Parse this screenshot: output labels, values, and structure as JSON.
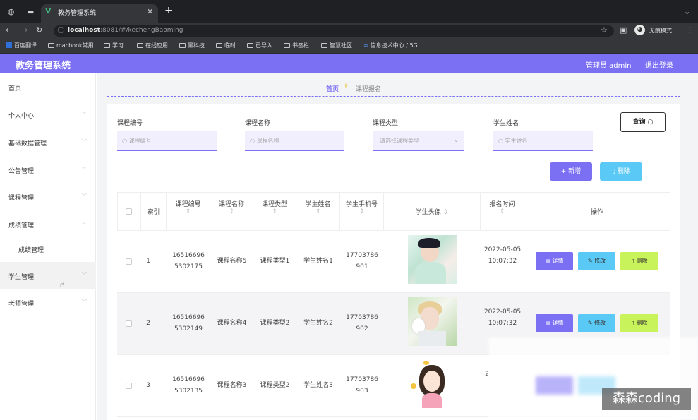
{
  "browser": {
    "tab_title": "教务管理系统",
    "url_host": "localhost",
    "url_rest": ":8081/#/kechengBaoming",
    "incognito_label": "无痕模式",
    "bookmarks": [
      "百度翻译",
      "macbook常用",
      "学习",
      "在线应用",
      "黑科技",
      "临时",
      "已导入",
      "书签栏",
      "智慧社区",
      "信息技术中心 / 5G..."
    ]
  },
  "header": {
    "title": "教务管理系统",
    "user": "管理员 admin",
    "logout": "退出登录"
  },
  "sidebar": {
    "items": [
      "首页",
      "个人中心",
      "基础数据管理",
      "公告管理",
      "课程管理",
      "成绩管理",
      "成绩管理",
      "学生管理",
      "老师管理"
    ]
  },
  "breadcrumb": {
    "home": "首页",
    "current": "课程报名"
  },
  "filters": {
    "course_code_label": "课程编号",
    "course_code_placeholder": "课程编号",
    "course_name_label": "课程名称",
    "course_name_placeholder": "课程名称",
    "course_type_label": "课程类型",
    "course_type_placeholder": "请选择课程类型",
    "student_name_label": "学生姓名",
    "student_name_placeholder": "学生姓名",
    "query_button": "查询"
  },
  "actions": {
    "add": "新增",
    "delete": "删除"
  },
  "table": {
    "headers": [
      "索引",
      "课程编号",
      "课程名称",
      "课程类型",
      "学生姓名",
      "学生手机号",
      "学生头像",
      "报名时间",
      "操作"
    ],
    "rows": [
      {
        "index": "1",
        "code": "16516696 5302175",
        "name": "课程名称5",
        "type": "课程类型1",
        "student": "学生姓名1",
        "phone": "17703786 901",
        "time": "2022-05-05 10:07:32"
      },
      {
        "index": "2",
        "code": "16516696 5302149",
        "name": "课程名称4",
        "type": "课程类型2",
        "student": "学生姓名2",
        "phone": "17703786 902",
        "time": "2022-05-05 10:07:32"
      },
      {
        "index": "3",
        "code": "16516696 5302135",
        "name": "课程名称3",
        "type": "课程类型2",
        "student": "学生姓名3",
        "phone": "17703786 903",
        "time": "2"
      }
    ],
    "op_detail": "详情",
    "op_edit": "修改",
    "op_delete": "删除"
  },
  "watermark": "森森coding",
  "colors": {
    "primary": "#7b70f4",
    "edit": "#5ac9f5",
    "delete": "#c9f35a"
  }
}
